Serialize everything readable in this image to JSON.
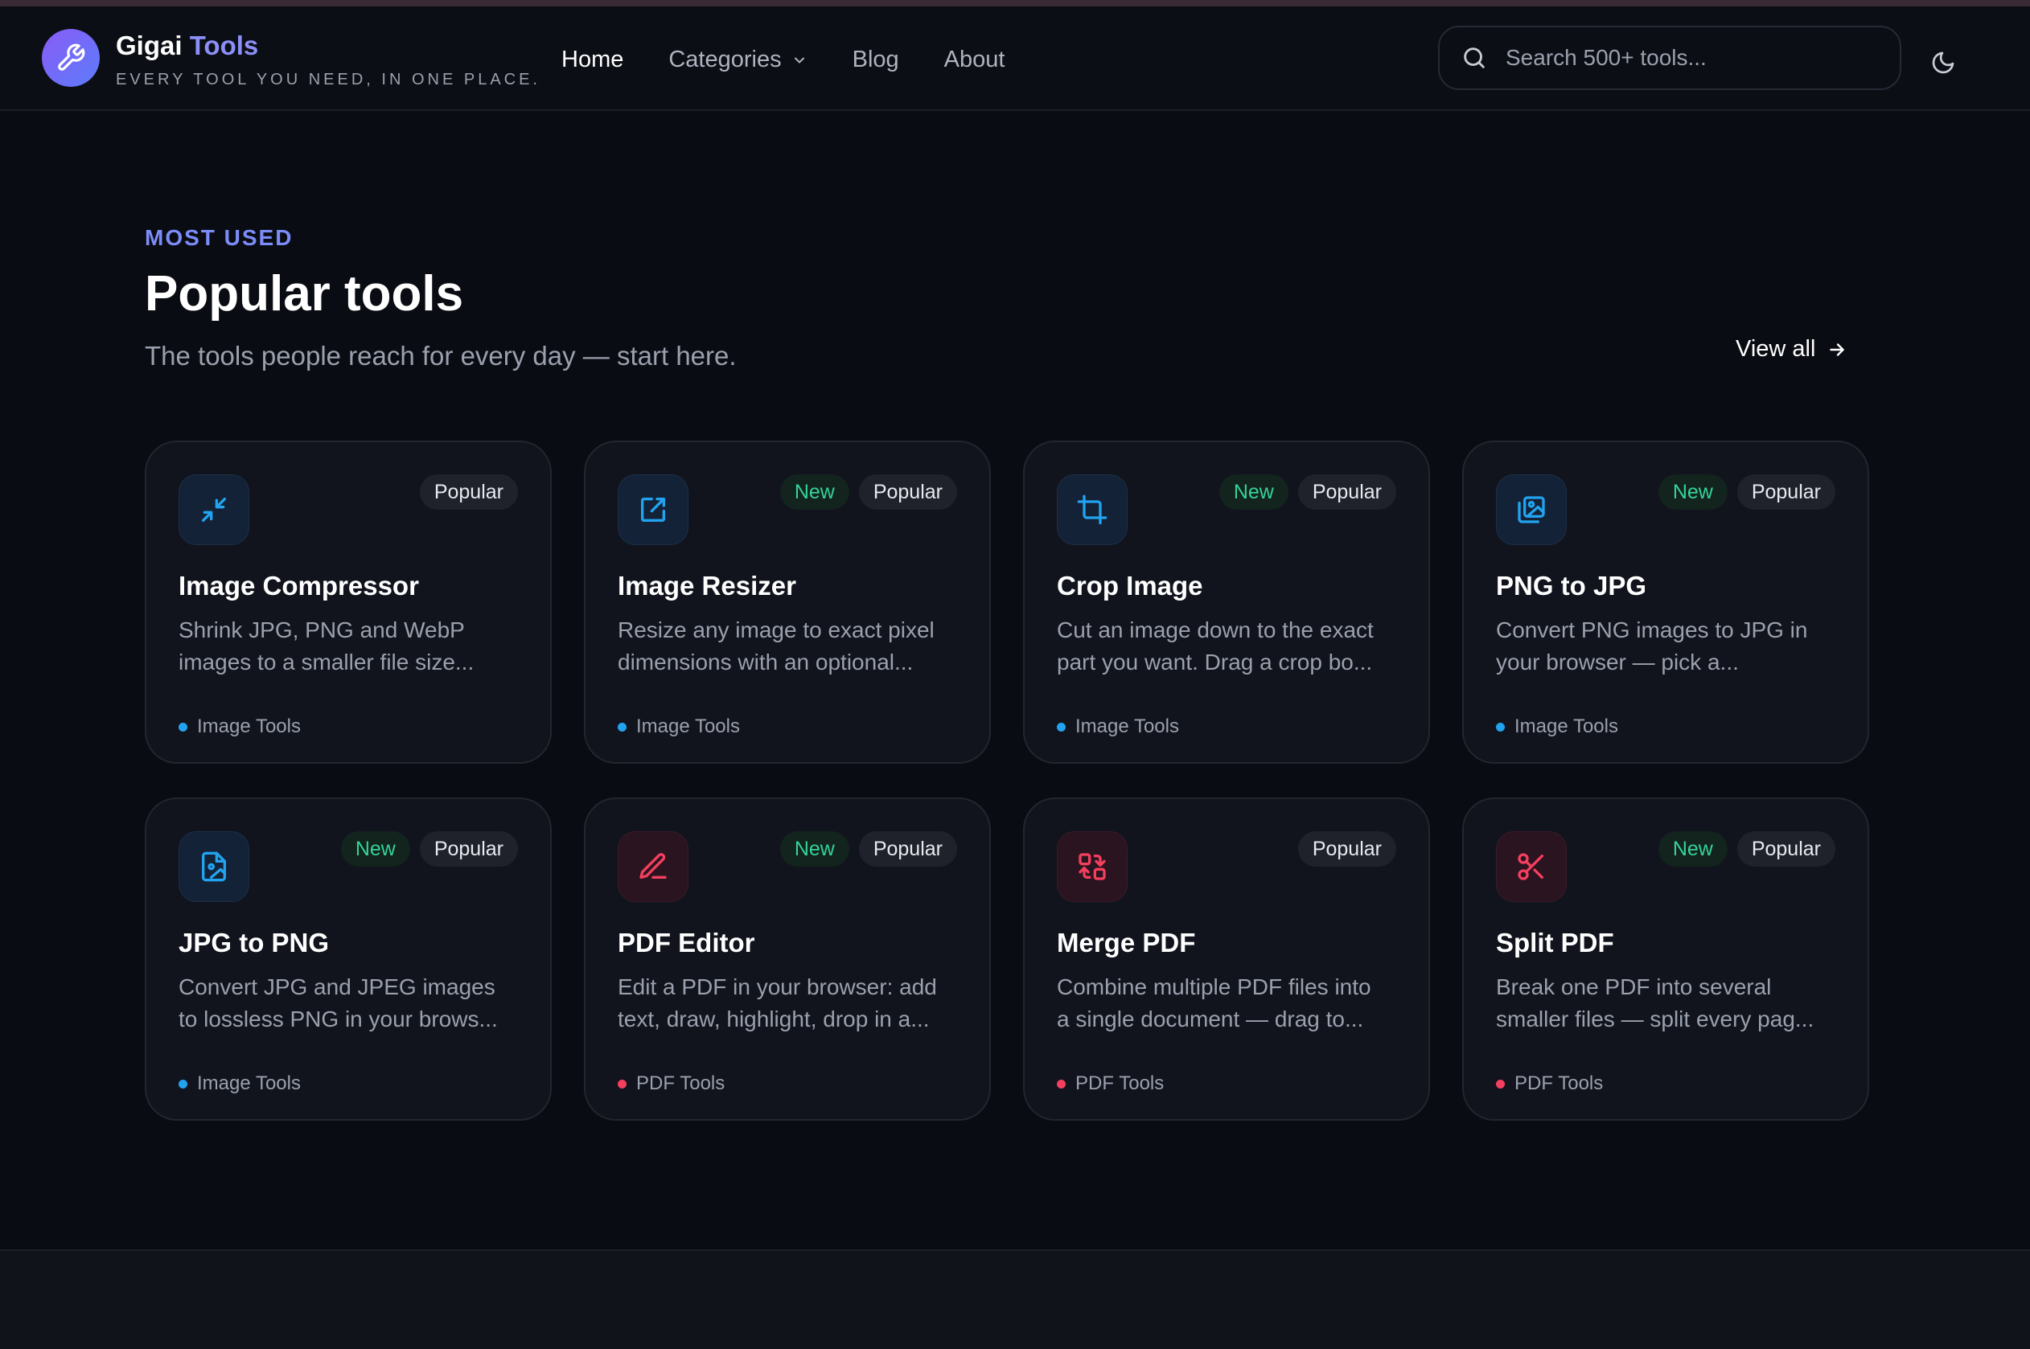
{
  "header": {
    "brand_name": "Gigai",
    "brand_accent": "Tools",
    "tagline": "EVERY TOOL YOU NEED, IN ONE PLACE.",
    "nav": [
      {
        "label": "Home",
        "active": true
      },
      {
        "label": "Categories",
        "dropdown": true
      },
      {
        "label": "Blog"
      },
      {
        "label": "About"
      }
    ],
    "search_placeholder": "Search 500+ tools...",
    "theme_toggle_icon": "moon-icon"
  },
  "section": {
    "eyebrow": "MOST USED",
    "title": "Popular tools",
    "subtitle": "The tools people reach for every day — start here.",
    "view_all": "View all"
  },
  "colors": {
    "accent": "#7c8cf8",
    "new_badge": "#34d399",
    "image_category": "#22a3f0",
    "pdf_category": "#f43f5e"
  },
  "tools": [
    {
      "title": "Image Compressor",
      "desc_line1": "Shrink JPG, PNG and WebP",
      "desc_line2": "images to a smaller file size...",
      "category": "Image Tools",
      "new": "",
      "popular": "Popular",
      "icon": "compress-arrows-icon"
    },
    {
      "title": "Image Resizer",
      "desc_line1": "Resize any image to exact pixel",
      "desc_line2": "dimensions with an optional...",
      "category": "Image Tools",
      "new": "New",
      "popular": "Popular",
      "icon": "resize-icon"
    },
    {
      "title": "Crop Image",
      "desc_line1": "Cut an image down to the exact",
      "desc_line2": "part you want. Drag a crop bo...",
      "category": "Image Tools",
      "new": "New",
      "popular": "Popular",
      "icon": "crop-icon"
    },
    {
      "title": "PNG to JPG",
      "desc_line1": "Convert PNG images to JPG in",
      "desc_line2": "your browser — pick a...",
      "category": "Image Tools",
      "new": "New",
      "popular": "Popular",
      "icon": "images-icon"
    },
    {
      "title": "JPG to PNG",
      "desc_line1": "Convert JPG and JPEG images",
      "desc_line2": "to lossless PNG in your brows...",
      "category": "Image Tools",
      "new": "New",
      "popular": "Popular",
      "icon": "file-image-icon"
    },
    {
      "title": "PDF Editor",
      "desc_line1": "Edit a PDF in your browser: add",
      "desc_line2": "text, draw, highlight, drop in a...",
      "category": "PDF Tools",
      "new": "New",
      "popular": "Popular",
      "icon": "pen-icon"
    },
    {
      "title": "Merge PDF",
      "desc_line1": "Combine multiple PDF files into",
      "desc_line2": "a single document — drag to...",
      "category": "PDF Tools",
      "new": "",
      "popular": "Popular",
      "icon": "merge-icon"
    },
    {
      "title": "Split PDF",
      "desc_line1": "Break one PDF into several",
      "desc_line2": "smaller files — split every pag...",
      "category": "PDF Tools",
      "new": "New",
      "popular": "Popular",
      "icon": "scissors-icon"
    }
  ]
}
